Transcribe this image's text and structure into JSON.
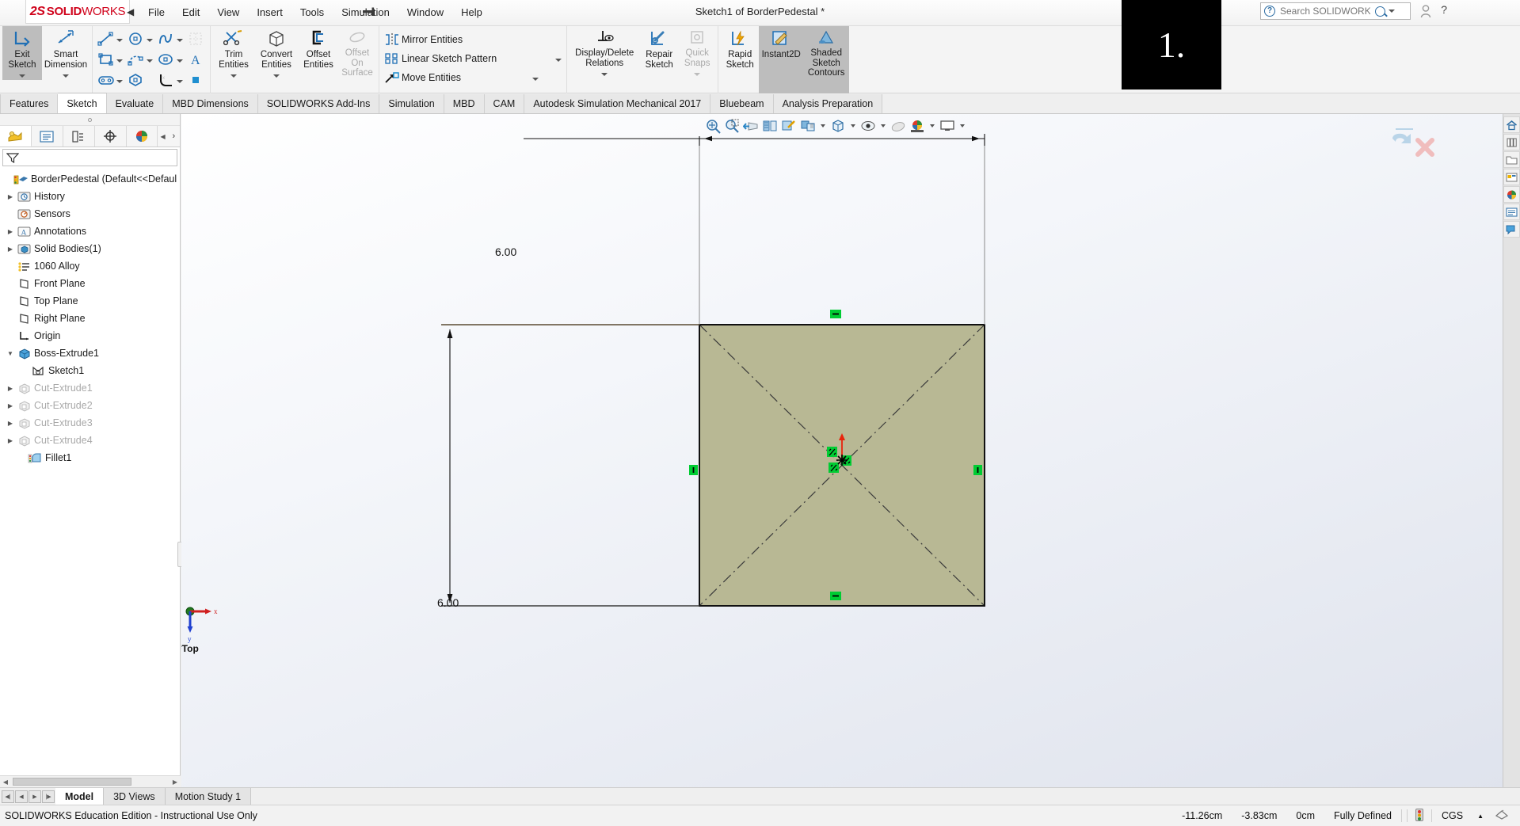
{
  "app": {
    "logo_ds": "2S",
    "logo_solid": "SOLID",
    "logo_works": "WORKS",
    "document_title": "Sketch1 of BorderPedestal *",
    "overlay_badge": "1."
  },
  "menu": {
    "items": [
      {
        "label": "File"
      },
      {
        "label": "Edit"
      },
      {
        "label": "View"
      },
      {
        "label": "Insert"
      },
      {
        "label": "Tools"
      },
      {
        "label": "Simulation"
      },
      {
        "label": "Window"
      },
      {
        "label": "Help"
      }
    ],
    "collapse_arrow": "◀",
    "pin_icon_name": "pin-icon"
  },
  "search": {
    "placeholder": "Search SOLIDWORKS Help",
    "value": "",
    "help_question": "?"
  },
  "ribbon": {
    "groups": [
      {
        "name": "sketch-mode",
        "buttons": [
          {
            "label": "Exit\nSketch",
            "icon": "exit-sketch-icon",
            "state": "selected",
            "dropdown": true
          },
          {
            "label": "Smart\nDimension",
            "icon": "smart-dimension-icon",
            "state": "normal",
            "dropdown": true
          }
        ]
      },
      {
        "name": "sketch-entities",
        "tools": [
          {
            "icon": "line-icon",
            "dropdown": true
          },
          {
            "icon": "rectangle-icon",
            "dropdown": true
          },
          {
            "icon": "slot-icon",
            "dropdown": true
          },
          {
            "icon": "circle-icon",
            "dropdown": true
          },
          {
            "icon": "arc-3point-icon",
            "dropdown": true
          },
          {
            "icon": "polygon-icon",
            "dropdown": false
          },
          {
            "icon": "spline-icon",
            "dropdown": true
          },
          {
            "icon": "ellipse-icon",
            "dropdown": true
          },
          {
            "icon": "fillet-icon",
            "dropdown": true
          },
          {
            "icon": "grid-snap-icon",
            "dropdown": false,
            "disabled": true
          },
          {
            "icon": "text-icon",
            "dropdown": false
          },
          {
            "icon": "point-icon",
            "dropdown": false
          }
        ]
      },
      {
        "name": "sketch-tools",
        "buttons": [
          {
            "label": "Trim\nEntities",
            "icon": "trim-entities-icon",
            "dropdown": true
          },
          {
            "label": "Convert\nEntities",
            "icon": "convert-entities-icon",
            "dropdown": true
          },
          {
            "label": "Offset\nEntities",
            "icon": "offset-entities-icon",
            "dropdown": false
          },
          {
            "label": "Offset\nOn\nSurface",
            "icon": "offset-on-surface-icon",
            "disabled": true,
            "dropdown": false
          }
        ]
      },
      {
        "name": "pattern-tools",
        "rows": [
          {
            "label": "Mirror Entities",
            "icon": "mirror-entities-icon",
            "dropdown": false
          },
          {
            "label": "Linear Sketch Pattern",
            "icon": "linear-sketch-pattern-icon",
            "dropdown": true
          },
          {
            "label": "Move Entities",
            "icon": "move-entities-icon",
            "dropdown": true
          }
        ]
      },
      {
        "name": "relations-tools",
        "buttons": [
          {
            "label": "Display/Delete\nRelations",
            "icon": "display-delete-relations-icon",
            "dropdown": true
          },
          {
            "label": "Repair\nSketch",
            "icon": "repair-sketch-icon",
            "dropdown": false
          },
          {
            "label": "Quick\nSnaps",
            "icon": "quick-snaps-icon",
            "disabled": true,
            "dropdown": true
          }
        ]
      },
      {
        "name": "sketch-modes",
        "buttons": [
          {
            "label": "Rapid\nSketch",
            "icon": "rapid-sketch-icon",
            "dropdown": false
          },
          {
            "label": "Instant2D",
            "icon": "instant2d-icon",
            "state": "selected",
            "dropdown": false
          },
          {
            "label": "Shaded\nSketch\nContours",
            "icon": "shaded-sketch-contours-icon",
            "state": "selected",
            "dropdown": false
          }
        ]
      }
    ]
  },
  "command_tabs": {
    "active": "Sketch",
    "items": [
      {
        "label": "Features"
      },
      {
        "label": "Sketch"
      },
      {
        "label": "Evaluate"
      },
      {
        "label": "MBD Dimensions"
      },
      {
        "label": "SOLIDWORKS Add-Ins"
      },
      {
        "label": "Simulation"
      },
      {
        "label": "MBD"
      },
      {
        "label": "CAM"
      },
      {
        "label": "Autodesk Simulation Mechanical 2017"
      },
      {
        "label": "Bluebeam"
      },
      {
        "label": "Analysis Preparation"
      }
    ]
  },
  "feature_manager": {
    "tabs": [
      {
        "name": "feature-tree-tab",
        "icon": "feature-tree-icon",
        "active": true
      },
      {
        "name": "property-manager-tab",
        "icon": "property-manager-icon",
        "active": false
      },
      {
        "name": "configuration-manager-tab",
        "icon": "configuration-manager-icon",
        "active": false
      },
      {
        "name": "dimxpert-manager-tab",
        "icon": "dimxpert-icon",
        "active": false
      },
      {
        "name": "display-manager-tab",
        "icon": "display-manager-icon",
        "active": false
      }
    ],
    "filter_placeholder": "",
    "tree": [
      {
        "label": "BorderPedestal  (Default<<Defaul",
        "icon": "part-icon",
        "indent": 0,
        "expander": "",
        "disabled": false,
        "root": true
      },
      {
        "label": "History",
        "icon": "history-icon",
        "indent": 1,
        "expander": "▶",
        "disabled": false
      },
      {
        "label": "Sensors",
        "icon": "sensors-icon",
        "indent": 1,
        "expander": "",
        "disabled": false
      },
      {
        "label": "Annotations",
        "icon": "annotations-icon",
        "indent": 1,
        "expander": "▶",
        "disabled": false
      },
      {
        "label": "Solid Bodies(1)",
        "icon": "solid-bodies-icon",
        "indent": 1,
        "expander": "▶",
        "disabled": false
      },
      {
        "label": "1060 Alloy",
        "icon": "material-icon",
        "indent": 1,
        "expander": "",
        "disabled": false
      },
      {
        "label": "Front Plane",
        "icon": "plane-icon",
        "indent": 1,
        "expander": "",
        "disabled": false
      },
      {
        "label": "Top Plane",
        "icon": "plane-icon",
        "indent": 1,
        "expander": "",
        "disabled": false
      },
      {
        "label": "Right Plane",
        "icon": "plane-icon",
        "indent": 1,
        "expander": "",
        "disabled": false
      },
      {
        "label": "Origin",
        "icon": "origin-icon",
        "indent": 1,
        "expander": "",
        "disabled": false
      },
      {
        "label": "Boss-Extrude1",
        "icon": "boss-extrude-icon",
        "indent": 1,
        "expander": "▼",
        "disabled": false
      },
      {
        "label": "Sketch1",
        "icon": "sketch-icon",
        "indent": 2,
        "expander": "",
        "disabled": false
      },
      {
        "label": "Cut-Extrude1",
        "icon": "cut-extrude-icon",
        "indent": 1,
        "expander": "▶",
        "disabled": true
      },
      {
        "label": "Cut-Extrude2",
        "icon": "cut-extrude-icon",
        "indent": 1,
        "expander": "▶",
        "disabled": true
      },
      {
        "label": "Cut-Extrude3",
        "icon": "cut-extrude-icon",
        "indent": 1,
        "expander": "▶",
        "disabled": true
      },
      {
        "label": "Cut-Extrude4",
        "icon": "cut-extrude-icon",
        "indent": 1,
        "expander": "▶",
        "disabled": true
      },
      {
        "label": "Fillet1",
        "icon": "fillet-feature-icon",
        "indent": 1,
        "expander": "",
        "disabled": false
      }
    ]
  },
  "viewport_toolbar": {
    "items": [
      {
        "name": "zoom-to-fit-icon"
      },
      {
        "name": "zoom-to-area-icon"
      },
      {
        "name": "previous-view-icon"
      },
      {
        "name": "section-view-icon"
      },
      {
        "name": "view-orientation-icon"
      },
      {
        "name": "display-style-icon",
        "dropdown": true
      },
      {
        "name": "hide-show-items-icon",
        "dropdown": true
      },
      {
        "name": "edit-appearance-icon",
        "dropdown": true
      },
      {
        "name": "apply-scene-icon",
        "dropdown": true
      },
      {
        "name": "view-settings-icon",
        "dropdown": true
      }
    ]
  },
  "sketch": {
    "dim_horizontal": "6.00",
    "dim_vertical": "6.00",
    "view_label": "*Top",
    "triad_x": "x",
    "triad_y": "y",
    "relations": [
      {
        "name": "horizontal-relation-top",
        "type": "horizontal"
      },
      {
        "name": "horizontal-relation-bottom",
        "type": "horizontal"
      },
      {
        "name": "vertical-relation-left",
        "type": "vertical"
      },
      {
        "name": "vertical-relation-right",
        "type": "vertical"
      },
      {
        "name": "midpoint-relation-1",
        "type": "midpoint"
      },
      {
        "name": "midpoint-relation-2",
        "type": "midpoint"
      },
      {
        "name": "midpoint-relation-3",
        "type": "midpoint"
      }
    ],
    "colors": {
      "face_fill": "#b8b894",
      "sketch_line": "#000000",
      "relation_green": "#00cc33",
      "origin_red": "#e8240c",
      "construction": "#3b3b3b"
    }
  },
  "bottom_tabs": {
    "active": "Model",
    "items": [
      {
        "label": "Model"
      },
      {
        "label": "3D Views"
      },
      {
        "label": "Motion Study 1"
      }
    ]
  },
  "status_bar": {
    "left_text": "SOLIDWORKS Education Edition - Instructional Use Only",
    "coord_x": "-11.26cm",
    "coord_y": "-3.83cm",
    "coord_z": "0cm",
    "sketch_state": "Fully Defined",
    "units": "CGS",
    "units_caret": "▲"
  },
  "task_pane": {
    "items": [
      {
        "name": "solidworks-resources-icon"
      },
      {
        "name": "design-library-icon"
      },
      {
        "name": "file-explorer-icon"
      },
      {
        "name": "view-palette-icon"
      },
      {
        "name": "appearances-scenes-icon"
      },
      {
        "name": "custom-properties-icon"
      },
      {
        "name": "solidworks-forum-icon"
      }
    ]
  },
  "window_controls": {
    "restore": "❐",
    "minimize": "—",
    "maximize": "❐",
    "close": "✕"
  }
}
